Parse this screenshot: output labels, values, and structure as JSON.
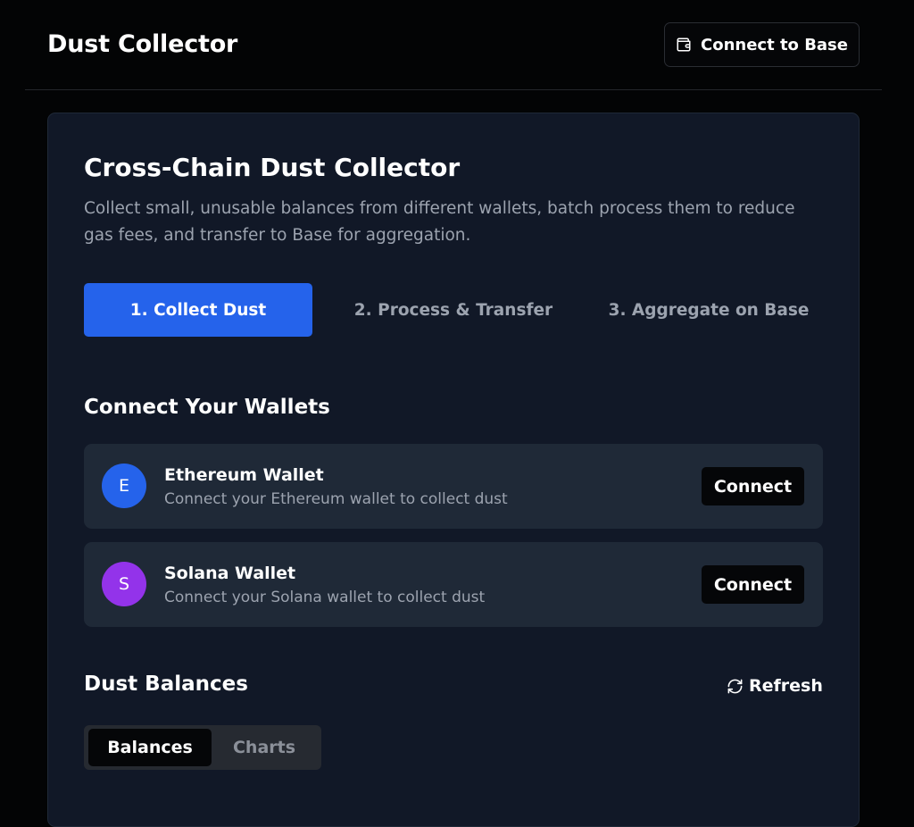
{
  "header": {
    "title": "Dust Collector",
    "connect_button": "Connect to Base",
    "connect_icon": "wallet-icon"
  },
  "main": {
    "title": "Cross-Chain Dust Collector",
    "description": "Collect small, unusable balances from different wallets, batch process them to reduce gas fees, and transfer to Base for aggregation.",
    "steps": [
      {
        "label": "1. Collect Dust",
        "active": true
      },
      {
        "label": "2. Process & Transfer",
        "active": false
      },
      {
        "label": "3. Aggregate on Base",
        "active": false
      }
    ],
    "accent_color": "#2563eb"
  },
  "wallets": {
    "title": "Connect Your Wallets",
    "items": [
      {
        "initial": "E",
        "name": "Ethereum Wallet",
        "subtitle": "Connect your Ethereum wallet to collect dust",
        "button": "Connect",
        "color": "#2563eb"
      },
      {
        "initial": "S",
        "name": "Solana Wallet",
        "subtitle": "Connect your Solana wallet to collect dust",
        "button": "Connect",
        "color": "#9333ea"
      }
    ]
  },
  "balances": {
    "title": "Dust Balances",
    "refresh_label": "Refresh",
    "refresh_icon": "refresh-icon",
    "tabs": [
      {
        "label": "Balances",
        "active": true
      },
      {
        "label": "Charts",
        "active": false
      }
    ]
  }
}
